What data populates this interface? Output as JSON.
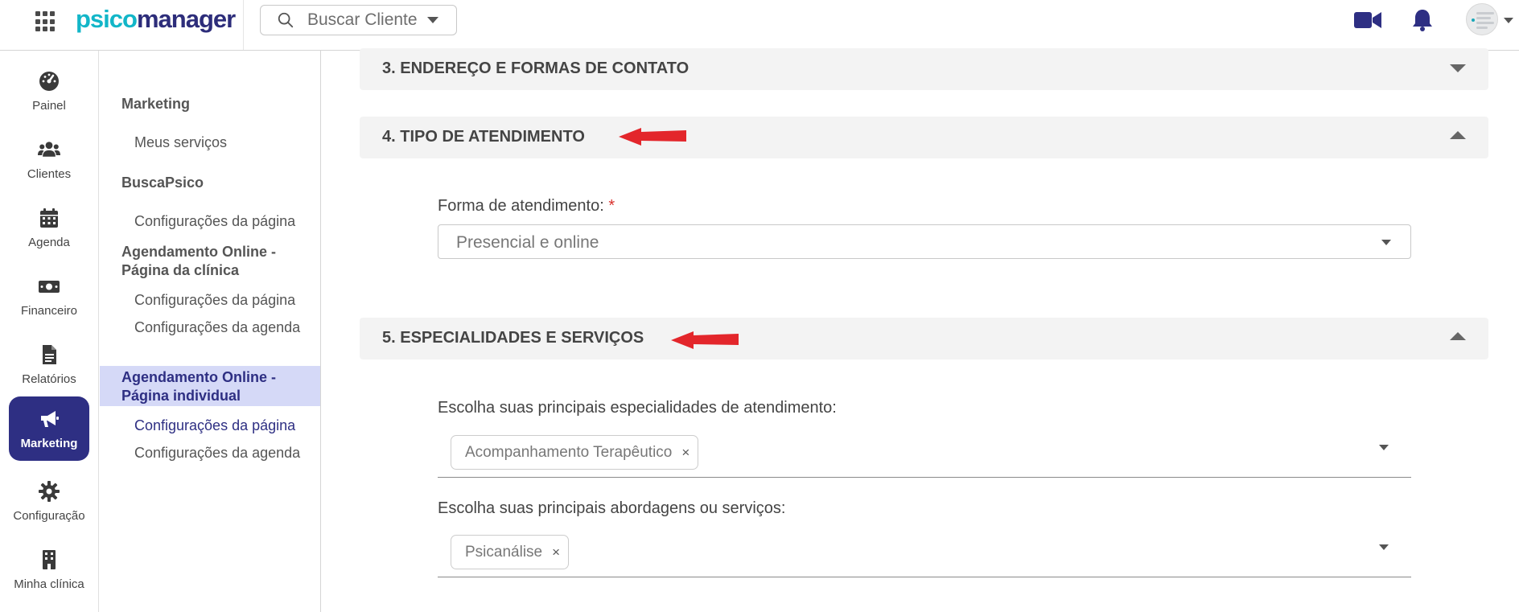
{
  "topbar": {
    "logo_part1": "psico",
    "logo_part2": "manager",
    "search_placeholder": "Buscar Cliente",
    "icons": [
      "apps-grid-icon",
      "search-icon",
      "video-camera-icon",
      "bell-icon",
      "avatar",
      "chevron-down-icon"
    ]
  },
  "leftnav": {
    "items": [
      {
        "label": "Painel",
        "icon": "dashboard-gauge-icon"
      },
      {
        "label": "Clientes",
        "icon": "users-icon"
      },
      {
        "label": "Agenda",
        "icon": "calendar-icon"
      },
      {
        "label": "Financeiro",
        "icon": "money-icon"
      },
      {
        "label": "Relatórios",
        "icon": "file-text-icon"
      },
      {
        "label": "Marketing",
        "icon": "megaphone-icon",
        "active": true
      },
      {
        "label": "Configuração",
        "icon": "gear-icon"
      },
      {
        "label": "Minha clínica",
        "icon": "building-icon"
      }
    ]
  },
  "subnav": {
    "group1": "Marketing",
    "group1_link1": "Meus serviços",
    "group2": "BuscaPsico",
    "group2_link1": "Configurações da página",
    "group3": "Agendamento Online - Página da clínica",
    "group3_link1": "Configurações da página",
    "group3_link2": "Configurações da agenda",
    "group4": "Agendamento Online - Página individual",
    "group4_link1": "Configurações da página",
    "group4_link2": "Configurações da agenda"
  },
  "main": {
    "section3_title": "3. ENDEREÇO E FORMAS DE CONTATO",
    "section4_title": "4. TIPO DE ATENDIMENTO",
    "forma_label": "Forma de atendimento:",
    "required_mark": "*",
    "forma_value": "Presencial e online",
    "section5_title": "5. ESPECIALIDADES E SERVIÇOS",
    "especialidades_label": "Escolha suas principais especialidades de atendimento:",
    "especialidades_chips": [
      "Acompanhamento Terapêutico"
    ],
    "abordagens_label": "Escolha suas principais abordagens ou serviços:",
    "abordagens_chips": [
      "Psicanálise"
    ],
    "chip_remove": "×"
  },
  "colors": {
    "brand_primary": "#2e2f83",
    "brand_accent": "#12b6c8",
    "active_sub_bg": "#d5d9f7",
    "annotation_arrow": "#e3262b",
    "required": "#d9302c"
  }
}
